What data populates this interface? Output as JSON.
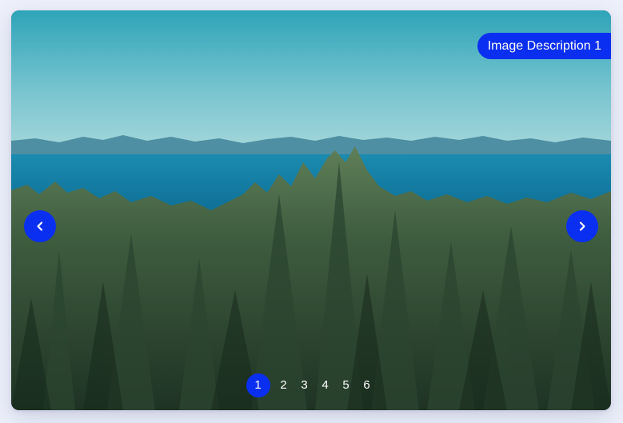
{
  "carousel": {
    "caption": "Image Description 1",
    "current_index": 1,
    "pages": [
      "1",
      "2",
      "3",
      "4",
      "5",
      "6"
    ],
    "image": "forest-sea-landscape-photo",
    "prev_icon": "chevron-left-icon",
    "next_icon": "chevron-right-icon",
    "accent_color": "#0b2ff0"
  }
}
